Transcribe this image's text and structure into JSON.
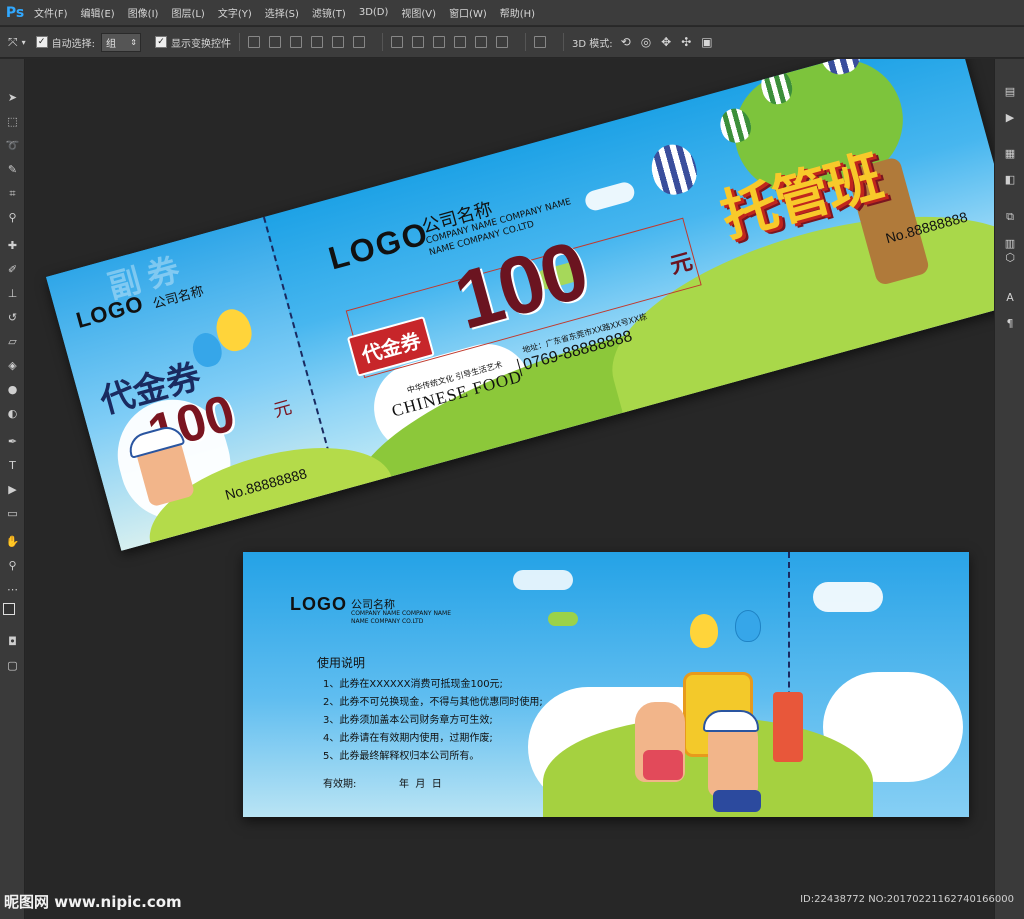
{
  "app": {
    "logo": "Ps"
  },
  "menu": [
    "文件(F)",
    "编辑(E)",
    "图像(I)",
    "图层(L)",
    "文字(Y)",
    "选择(S)",
    "滤镜(T)",
    "3D(D)",
    "视图(V)",
    "窗口(W)",
    "帮助(H)"
  ],
  "options": {
    "auto_select_label": "自动选择:",
    "auto_select_value": "组",
    "show_transform_label": "显示变换控件",
    "mode_3d_label": "3D 模式:"
  },
  "front": {
    "stub": {
      "logo": "LOGO",
      "company": "公司名称",
      "watermark": "副券",
      "title": "代金券",
      "amount": "100",
      "unit": "元",
      "serial": "No.88888888"
    },
    "main": {
      "logo": "LOGO",
      "company": "公司名称",
      "company_en1": "COMPANY NAME COMPANY NAME",
      "company_en2": "NAME COMPANY CO.LTD",
      "badge": "代金券",
      "amount": "100",
      "unit": "元",
      "address": "地址：广东省东莞市XX路XX号XX栋",
      "phone": "0769-88888888",
      "slogan": "中华传统文化 引导生活艺术",
      "brand": "CHINESE FOOD",
      "title": "托管班",
      "serial": "No.88888888"
    }
  },
  "back": {
    "logo": "LOGO",
    "company": "公司名称",
    "company_en1": "COMPANY NAME COMPANY NAME",
    "company_en2": "NAME COMPANY CO.LTD",
    "instructions_title": "使用说明",
    "instructions": [
      "1、此券在XXXXXX消费可抵现金100元;",
      "2、此券不可兑换现金，不得与其他优惠同时使用;",
      "3、此券须加盖本公司财务章方可生效;",
      "4、此券请在有效期内使用，过期作废;",
      "5、此券最终解释权归本公司所有。"
    ],
    "validity_label": "有效期:",
    "validity_date": "年  月  日"
  },
  "footer": {
    "watermark": "昵图网 www.nipic.com",
    "id": "ID:22438772 NO:20170221162740166000"
  },
  "colors": {
    "accent_red": "#7a1520",
    "sky_blue": "#1ea2e6",
    "grass_green": "#8bcc3a",
    "title_yellow": "#f8c92a"
  }
}
